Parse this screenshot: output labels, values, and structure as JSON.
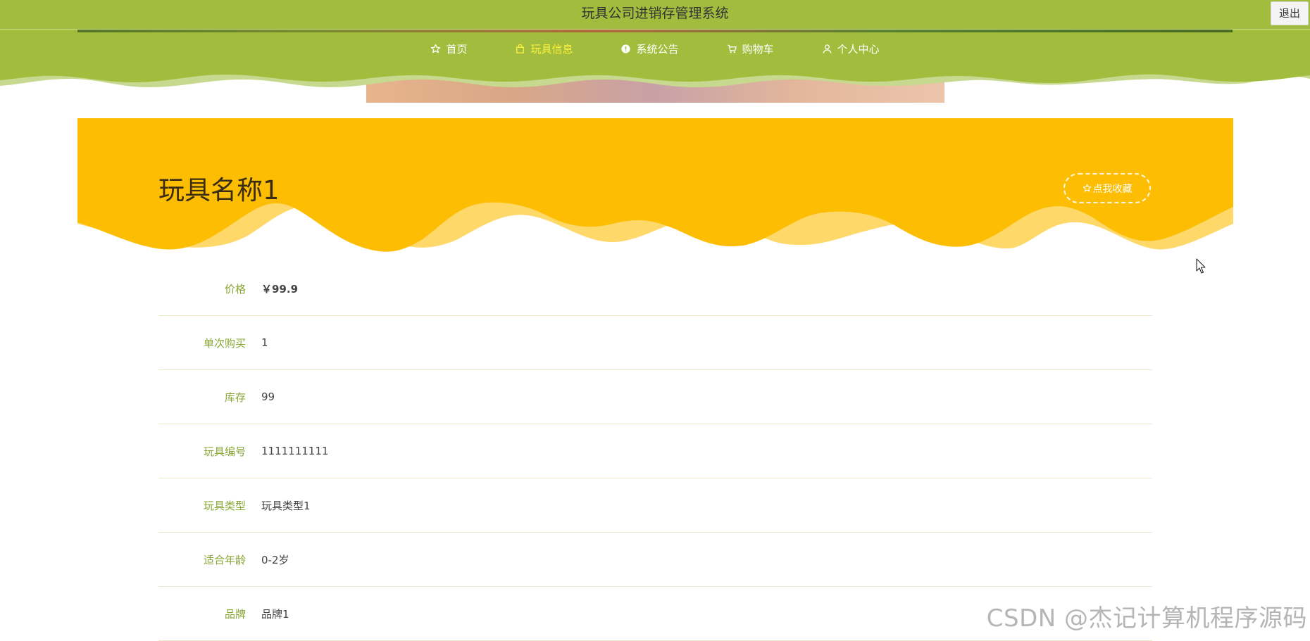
{
  "app": {
    "title": "玩具公司进销存管理系统",
    "logout_label": "退出"
  },
  "nav": [
    {
      "label": "首页",
      "icon": "star-outline-icon",
      "active": false
    },
    {
      "label": "玩具信息",
      "icon": "bag-icon",
      "active": true
    },
    {
      "label": "系统公告",
      "icon": "alert-circle-icon",
      "active": false
    },
    {
      "label": "购物车",
      "icon": "cart-icon",
      "active": false
    },
    {
      "label": "个人中心",
      "icon": "user-icon",
      "active": false
    }
  ],
  "product": {
    "name": "玩具名称1",
    "favorite_label": "点我收藏",
    "fields": [
      {
        "label": "价格",
        "value": "￥99.9"
      },
      {
        "label": "单次购买",
        "value": "1"
      },
      {
        "label": "库存",
        "value": "99"
      },
      {
        "label": "玩具编号",
        "value": "1111111111"
      },
      {
        "label": "玩具类型",
        "value": "玩具类型1"
      },
      {
        "label": "适合年龄",
        "value": "0-2岁"
      },
      {
        "label": "品牌",
        "value": "品牌1"
      }
    ]
  },
  "watermark": "CSDN @杰记计算机程序源码",
  "colors": {
    "header_green": "#a2bd3e",
    "active_nav": "#fff23d",
    "panel_yellow": "#fdbd02",
    "panel_wave_light": "#ffd86a",
    "label_green": "#8aa634"
  }
}
